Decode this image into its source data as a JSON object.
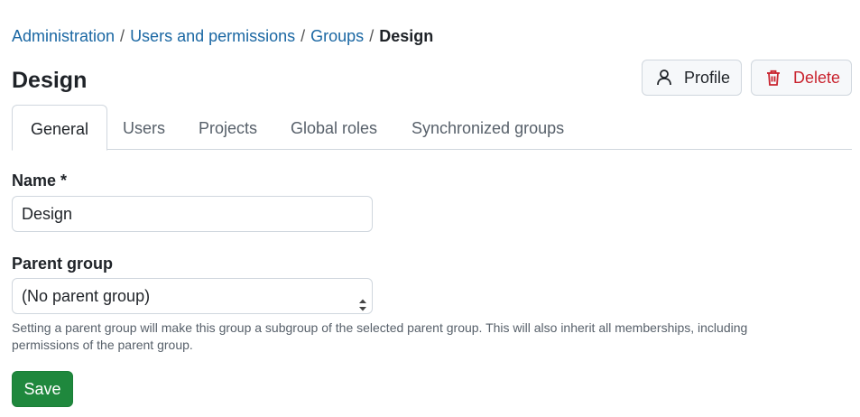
{
  "breadcrumb": {
    "items": [
      "Administration",
      "Users and permissions",
      "Groups"
    ],
    "separator": "/",
    "current": "Design"
  },
  "page": {
    "title": "Design"
  },
  "actions": {
    "profile_label": "Profile",
    "delete_label": "Delete"
  },
  "tabs": [
    {
      "label": "General",
      "active": true
    },
    {
      "label": "Users"
    },
    {
      "label": "Projects"
    },
    {
      "label": "Global roles"
    },
    {
      "label": "Synchronized groups"
    }
  ],
  "form": {
    "name_label": "Name *",
    "name_value": "Design",
    "parent_label": "Parent group",
    "parent_value": "(No parent group)",
    "parent_hint": "Setting a parent group will make this group a subgroup of the selected parent group. This will also inherit all memberships, including permissions of the parent group.",
    "save_label": "Save"
  },
  "colors": {
    "link": "#1a67a3",
    "danger": "#c9242f",
    "primary": "#1f883d"
  },
  "icons": {
    "profile": "user-icon",
    "delete": "trash-icon",
    "select": "chevron-up-down-icon"
  }
}
